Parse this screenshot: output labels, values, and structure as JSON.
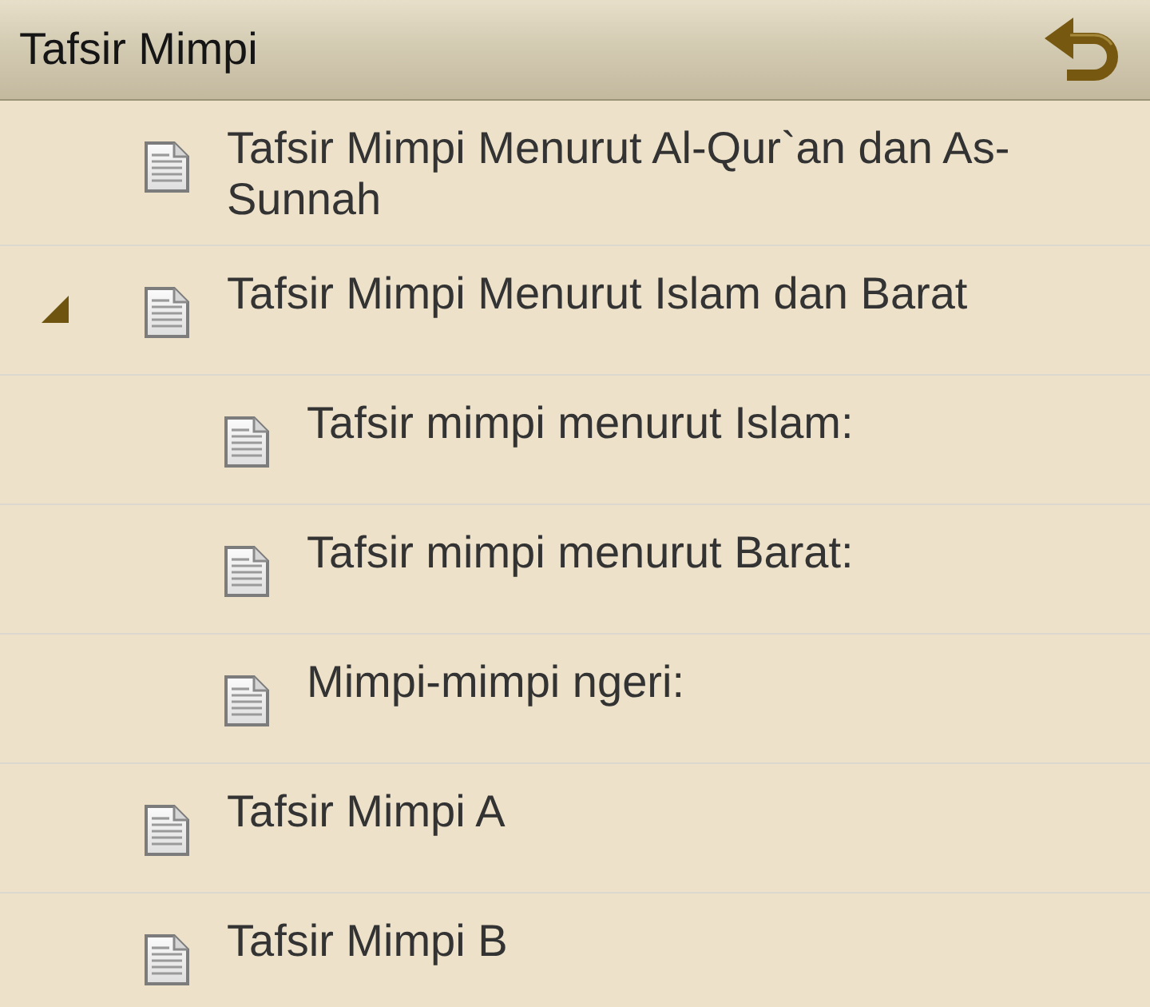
{
  "header": {
    "title": "Tafsir Mimpi"
  },
  "tree": [
    {
      "label": "Tafsir Mimpi Menurut Al-Qur`an dan As-Sunnah"
    },
    {
      "label": "Tafsir Mimpi Menurut Islam dan Barat",
      "expanded": true,
      "children": [
        {
          "label": "Tafsir mimpi menurut Islam:"
        },
        {
          "label": "Tafsir mimpi menurut Barat:"
        },
        {
          "label": "Mimpi-mimpi ngeri:"
        }
      ]
    },
    {
      "label": "Tafsir Mimpi A"
    },
    {
      "label": "Tafsir Mimpi B"
    }
  ]
}
